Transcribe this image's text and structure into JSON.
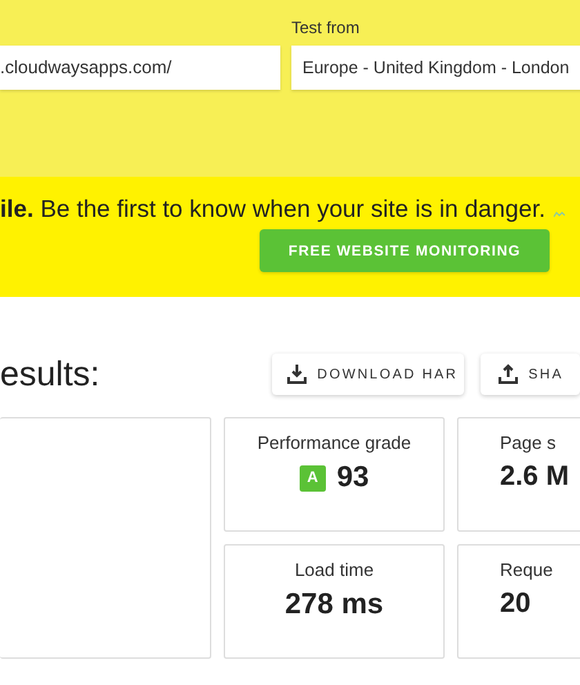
{
  "url_field": {
    "value": ".cloudwaysapps.com/"
  },
  "location": {
    "label": "Test from",
    "value": "Europe - United Kingdom - London"
  },
  "banner": {
    "text": "**ile.** Be the first to know when your site is in danger.",
    "button": "FREE WEBSITE MONITORING"
  },
  "results": {
    "heading": "esults:",
    "actions": [
      {
        "label": "DOWNLOAD HAR",
        "kind": "download"
      },
      {
        "label": "SHA",
        "kind": "share"
      }
    ]
  },
  "metrics": [
    {
      "label": "Performance grade",
      "grade": "A",
      "value": "93"
    },
    {
      "label": "Page s",
      "value": "2.6 M"
    },
    {
      "label": "Load time",
      "value": "278 ms"
    },
    {
      "label": "Reque",
      "value": "20"
    }
  ]
}
